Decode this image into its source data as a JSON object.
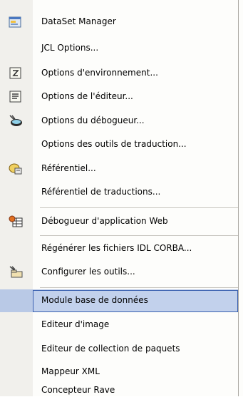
{
  "menu": {
    "items": [
      {
        "label": "DataSet Manager",
        "icon": "dataset-manager-icon"
      },
      {
        "label": "JCL Options...",
        "icon": ""
      },
      {
        "label": "Options d'environnement...",
        "icon": "environment-options-icon"
      },
      {
        "label": "Options de l'éditeur...",
        "icon": "editor-options-icon"
      },
      {
        "label": "Options du débogueur...",
        "icon": "debugger-options-icon"
      },
      {
        "label": "Options des outils de traduction...",
        "icon": ""
      },
      {
        "label": "Référentiel...",
        "icon": "repository-icon"
      },
      {
        "label": "Référentiel de traductions...",
        "icon": ""
      },
      {
        "label": "Débogueur d'application Web",
        "icon": "web-debugger-icon"
      },
      {
        "label": "Régénérer les fichiers IDL CORBA...",
        "icon": ""
      },
      {
        "label": "Configurer les outils...",
        "icon": "configure-tools-icon"
      },
      {
        "label": "Module base de données",
        "icon": "",
        "selected": true
      },
      {
        "label": "Editeur d'image",
        "icon": ""
      },
      {
        "label": "Editeur de collection de paquets",
        "icon": ""
      },
      {
        "label": "Mappeur XML",
        "icon": ""
      },
      {
        "label": "Concepteur Rave",
        "icon": ""
      }
    ]
  },
  "colors": {
    "selection_fill": "#c2d1ec",
    "selection_border": "#3b61b0",
    "gutter": "#f1f0ec"
  }
}
